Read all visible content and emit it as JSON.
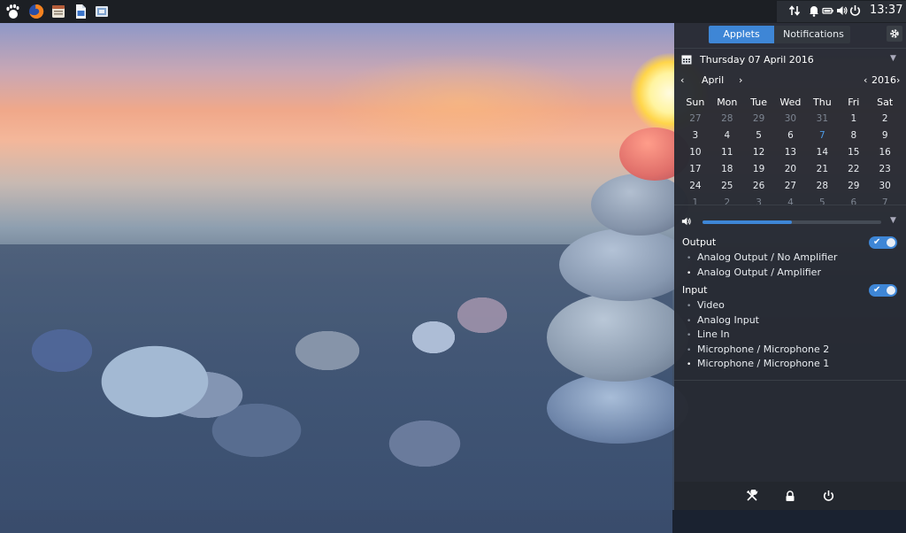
{
  "top_panel": {
    "launchers": [
      {
        "name": "gnome-foot-icon"
      },
      {
        "name": "firefox-icon"
      },
      {
        "name": "file-manager-icon"
      },
      {
        "name": "writer-icon"
      },
      {
        "name": "screenshot-icon"
      }
    ],
    "tray": {
      "icons": [
        "network-transfer-icon",
        "bell-icon",
        "battery-icon",
        "speaker-icon",
        "power-icon"
      ],
      "clock": "13:37"
    }
  },
  "side_panel": {
    "tabs": [
      {
        "label": "Applets",
        "active": true
      },
      {
        "label": "Notifications",
        "active": false
      }
    ],
    "date": "Thursday 07 April 2016",
    "calendar": {
      "month": "April",
      "year": "2016",
      "weekdays": [
        "Sun",
        "Mon",
        "Tue",
        "Wed",
        "Thu",
        "Fri",
        "Sat"
      ],
      "weeks": [
        [
          "27",
          "28",
          "29",
          "30",
          "31",
          "1",
          "2"
        ],
        [
          "3",
          "4",
          "5",
          "6",
          "7",
          "8",
          "9"
        ],
        [
          "10",
          "11",
          "12",
          "13",
          "14",
          "15",
          "16"
        ],
        [
          "17",
          "18",
          "19",
          "20",
          "21",
          "22",
          "23"
        ],
        [
          "24",
          "25",
          "26",
          "27",
          "28",
          "29",
          "30"
        ],
        [
          "1",
          "2",
          "3",
          "4",
          "5",
          "6",
          "7"
        ]
      ],
      "today": "7"
    },
    "volume": {
      "level": 0.5
    },
    "output": {
      "label": "Output",
      "enabled": true,
      "devices": [
        "Analog Output / No Amplifier",
        "Analog Output / Amplifier"
      ],
      "active_index": 1
    },
    "input": {
      "label": "Input",
      "enabled": true,
      "devices": [
        "Video",
        "Analog Input",
        "Line In",
        "Microphone / Microphone 2",
        "Microphone / Microphone 1"
      ],
      "active_index": 4
    },
    "bottom_buttons": [
      "tools-icon",
      "lock-icon",
      "power-icon"
    ]
  },
  "colors": {
    "accent": "#3e86d6",
    "panel_bg": "#262a32",
    "top_bar_bg": "#1c1f24"
  }
}
